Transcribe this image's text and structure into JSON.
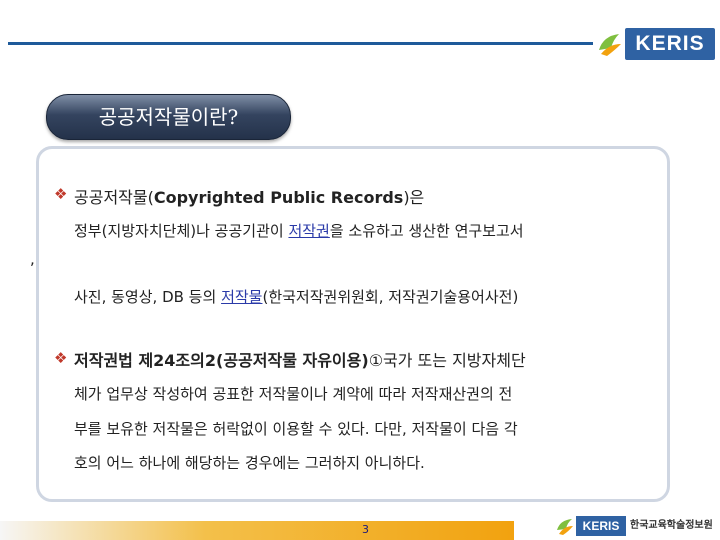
{
  "header": {
    "logo_text": "KERIS"
  },
  "title": "공공저작물이란?",
  "section1": {
    "heading_pre": "공공저작물(",
    "heading_en": "Copyrighted Public Records",
    "heading_post": ")은",
    "line2_pre": "정부(지방자치단체)나 공공기관이 ",
    "line2_link": "저작권",
    "line2_post": "을 소유하고 생산한 연구보고서",
    "line3_comma": ",",
    "line4_pre": "사진, 동영상, DB 등의 ",
    "line4_link": "저작물",
    "line4_post": "(한국저작권위원회, 저작권기술용어사전)"
  },
  "section2": {
    "heading_bold": "저작권법 제24조의2(공공저작물 자유이용)",
    "heading_rest": "①국가 또는 지방자체단",
    "line2": "체가 업무상 작성하여 공표한 저작물이나 계약에 따라 저작재산권의 전",
    "line3": "부를 보유한 저작물은 허락없이 이용할 수 있다. 다만, 저작물이 다음 각",
    "line4": "호의 어느 하나에 해당하는 경우에는 그러하지 아니하다."
  },
  "footer": {
    "page_number": "3",
    "logo_text": "KERIS",
    "org_name": "한국교육학술정보원"
  },
  "colors": {
    "accent": "#2f62a3",
    "bullet": "#c0392b",
    "link": "#2a3aa8",
    "footer_bar": "#f2a20f"
  }
}
